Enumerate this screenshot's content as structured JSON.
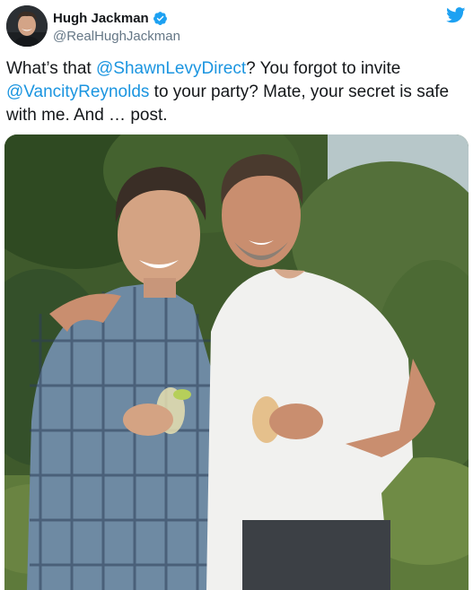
{
  "author": {
    "display_name": "Hugh Jackman",
    "handle": "@RealHughJackman",
    "verified": true,
    "avatar_icon": "profile-avatar",
    "verified_icon": "verified-badge-icon"
  },
  "brand": {
    "icon": "twitter-bird-icon",
    "color": "#1da1f2"
  },
  "tweet": {
    "text_part1": "What’s that ",
    "mention1": "@ShawnLevyDirect",
    "text_part2": "? You forgot to invite ",
    "mention2": "@VancityReynolds",
    "text_part3": " to your party? Mate, your secret is safe with me. And … post."
  },
  "colors": {
    "mention": "#1b95e0",
    "text": "#14171a",
    "secondary": "#657786"
  }
}
